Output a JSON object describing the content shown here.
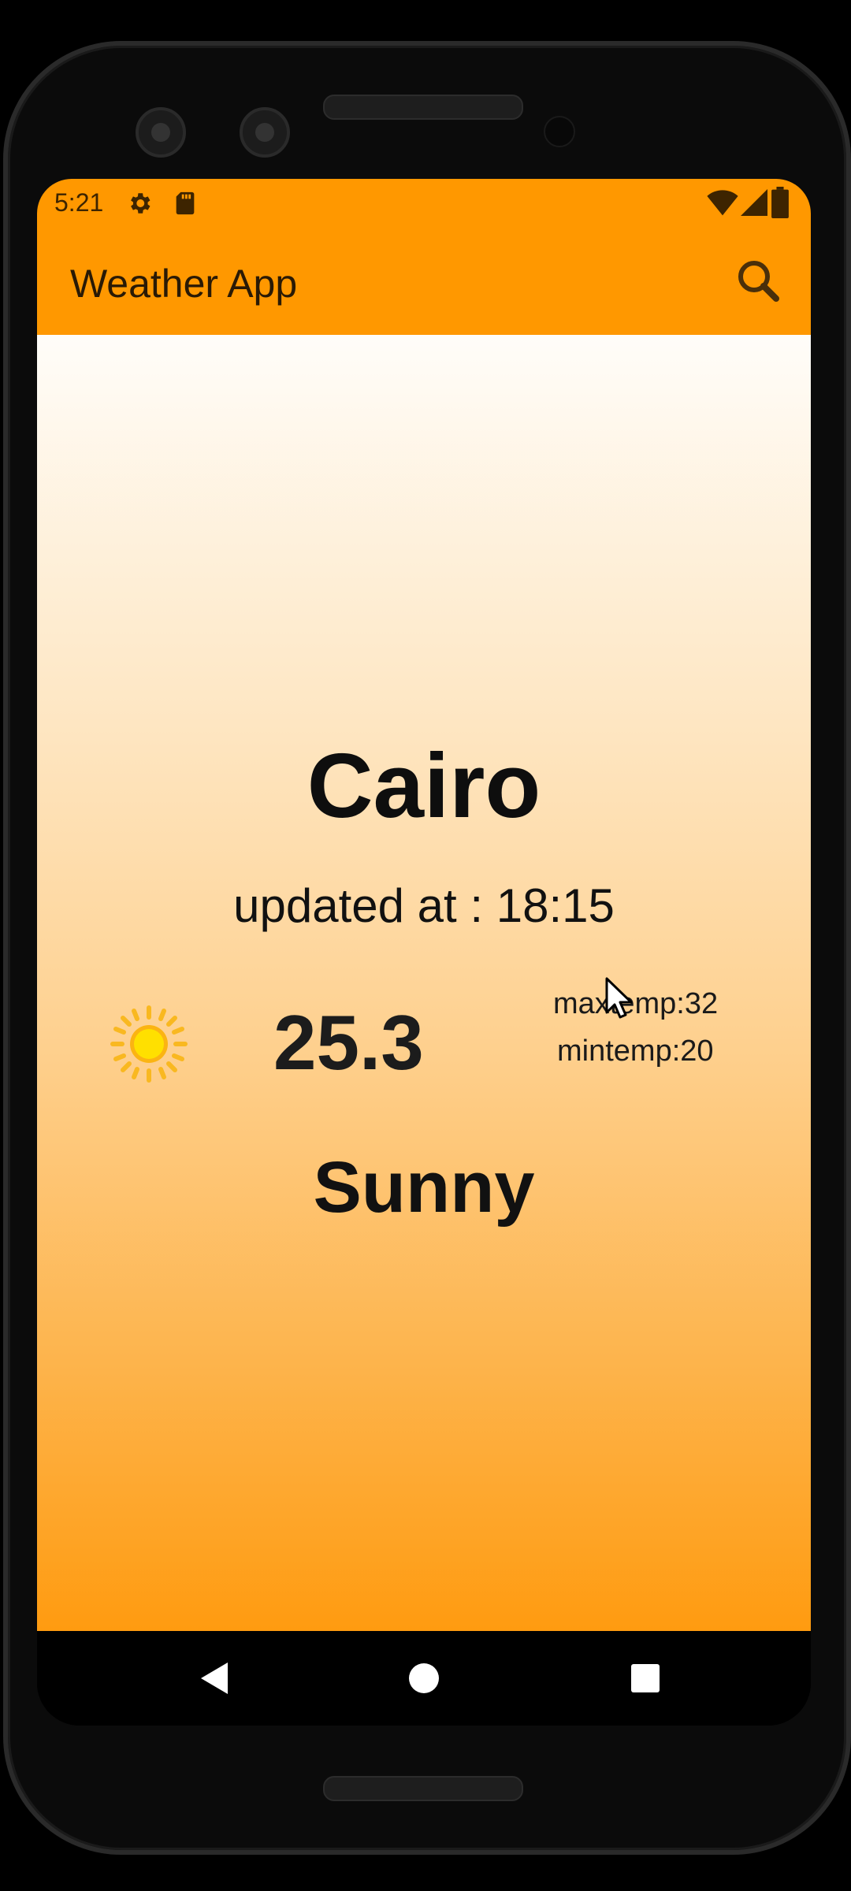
{
  "status_bar": {
    "time": "5:21",
    "left_icons": [
      "gear-icon",
      "sd-card-icon"
    ],
    "right_icons": [
      "wifi-icon",
      "signal-icon",
      "battery-icon"
    ]
  },
  "app_bar": {
    "title": "Weather App",
    "search_icon": "search-icon",
    "color": "#ff9800"
  },
  "weather": {
    "city": "Cairo",
    "updated": "updated at : 18:15",
    "temp": "25.3",
    "maxtemp": "maxtemp:32",
    "mintemp": "mintemp:20",
    "condition": "Sunny",
    "condition_icon": "sun-icon"
  },
  "nav_bar": {
    "buttons": [
      "back-icon",
      "home-icon",
      "recents-icon"
    ]
  }
}
